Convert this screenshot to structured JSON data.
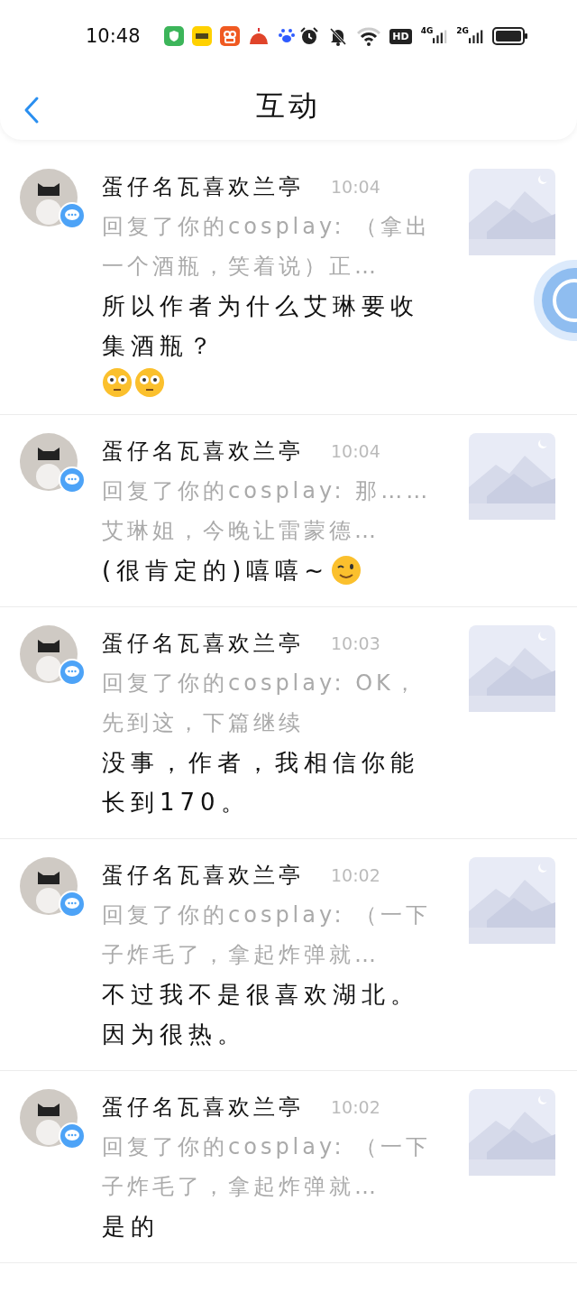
{
  "status_bar": {
    "time": "10:48",
    "hd": "HD",
    "net1": "4G",
    "net2": "2G"
  },
  "header": {
    "title": "互动"
  },
  "items": [
    {
      "user": "蛋仔名瓦喜欢兰亭",
      "time": "10:04",
      "quote": "回复了你的cosplay: （拿出一个酒瓶，笑着说）正…",
      "comment": "所以作者为什么艾琳要收集酒瓶？",
      "emojis": [
        {
          "kind": "flushed"
        },
        {
          "kind": "flushed"
        }
      ]
    },
    {
      "user": "蛋仔名瓦喜欢兰亭",
      "time": "10:04",
      "quote": "回复了你的cosplay: 那……艾琳姐，今晚让雷蒙德…",
      "comment": "(很肯定的)嘻嘻~",
      "emojis": [
        {
          "kind": "wink"
        }
      ]
    },
    {
      "user": "蛋仔名瓦喜欢兰亭",
      "time": "10:03",
      "quote": "回复了你的cosplay: OK，先到这，下篇继续",
      "comment": "没事，作者，我相信你能长到170。"
    },
    {
      "user": "蛋仔名瓦喜欢兰亭",
      "time": "10:02",
      "quote": "回复了你的cosplay: （一下子炸毛了，拿起炸弹就…",
      "comment": "不过我不是很喜欢湖北。因为很热。"
    },
    {
      "user": "蛋仔名瓦喜欢兰亭",
      "time": "10:02",
      "quote": "回复了你的cosplay: （一下子炸毛了，拿起炸弹就…",
      "comment": "是的"
    }
  ]
}
